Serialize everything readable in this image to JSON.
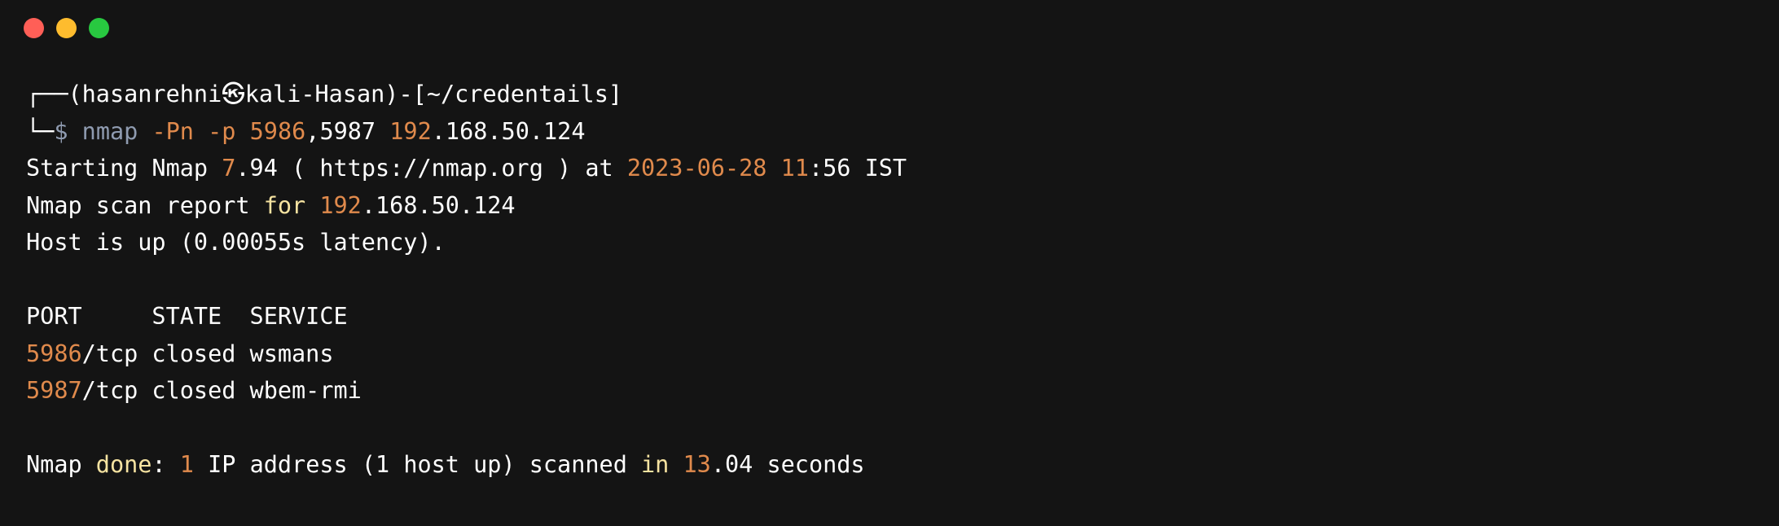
{
  "window": {
    "controls": [
      "close",
      "minimize",
      "maximize"
    ]
  },
  "prompt": {
    "box_top": "┌──",
    "user_host": "(hasanrehni㉿kali-Hasan)",
    "dash": "-",
    "cwd": "[~/credentails]",
    "box_bottom": "└─",
    "dollar": "$",
    "command": "nmap",
    "flag_pn": "-Pn",
    "flag_p": "-p",
    "port1": "5986",
    "port_sep": ",",
    "port2": "5987",
    "ip_first": "192",
    "ip_rest": ".168.50.124"
  },
  "output": {
    "starting_prefix": "Starting Nmap ",
    "version_major": "7",
    "version_rest": ".94 ( https://nmap.org ) at ",
    "date_year": "2023",
    "date_sep1": "-",
    "date_month": "06",
    "date_sep2": "-",
    "date_day": "28",
    "time_hour": "11",
    "time_rest": ":56 IST",
    "report_prefix": "Nmap scan report ",
    "report_for": "for",
    "report_ip_first": "192",
    "report_ip_rest": ".168.50.124",
    "host_up": "Host is up (0.00055s latency).",
    "table_header": "PORT     STATE  SERVICE",
    "rows": [
      {
        "port": "5986",
        "rest": "/tcp closed wsmans"
      },
      {
        "port": "5987",
        "rest": "/tcp closed wbem-rmi"
      }
    ],
    "done_prefix": "Nmap ",
    "done_word": "done",
    "done_colon": ": ",
    "done_count": "1",
    "done_mid": " IP address (1 host up) scanned ",
    "done_in": "in",
    "done_secs_int": "13",
    "done_secs_rest": ".04 seconds"
  }
}
